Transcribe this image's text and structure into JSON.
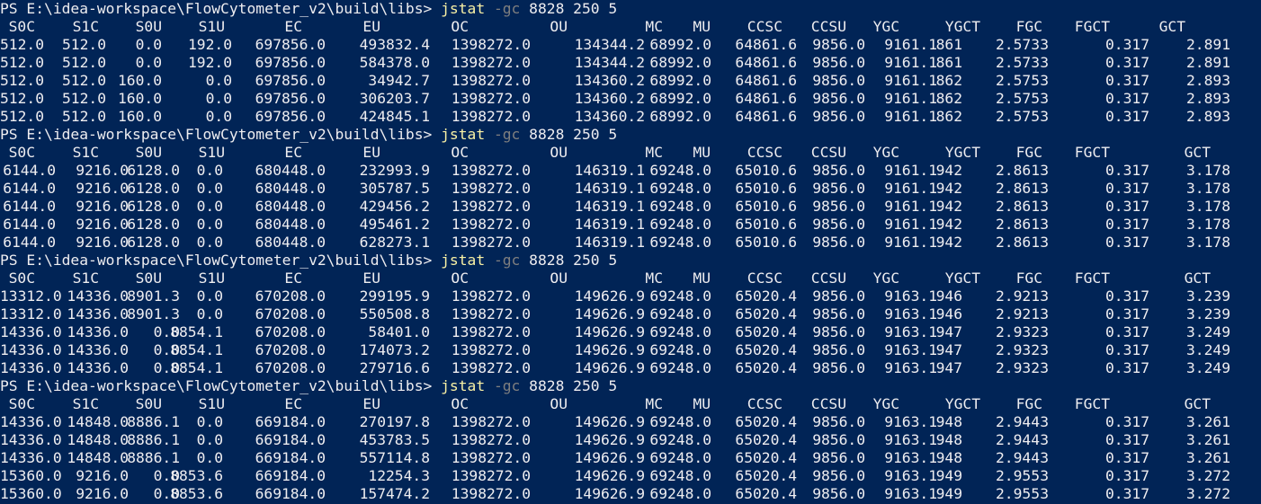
{
  "colors": {
    "background": "#012456",
    "foreground": "#eeedf0",
    "command": "#f9f1a5",
    "parameter": "#7f7f7f"
  },
  "blocks": [
    {
      "prompt": "PS E:\\idea-workspace\\FlowCytometer_v2\\build\\libs> ",
      "command": "jstat",
      "parameter": "-gc",
      "args": "8828 250 5",
      "header": [
        "S0C",
        "S1C",
        "S0U",
        "S1U",
        "EC",
        "EU",
        "OC",
        "OU",
        "MC",
        "MU",
        "CCSC",
        "CCSU",
        "YGC",
        "YGCT",
        "FGC",
        "FGCT",
        "GCT"
      ],
      "rows": [
        [
          "512.0",
          "512.0",
          "0.0",
          "192.0",
          "697856.0",
          "493832.4",
          "1398272.0",
          "134344.2",
          "68992.0",
          "64861.6",
          "9856.0",
          "9161.1",
          "861",
          "2.573",
          "3",
          "0.317",
          "2.891"
        ],
        [
          "512.0",
          "512.0",
          "0.0",
          "192.0",
          "697856.0",
          "584378.0",
          "1398272.0",
          "134344.2",
          "68992.0",
          "64861.6",
          "9856.0",
          "9161.1",
          "861",
          "2.573",
          "3",
          "0.317",
          "2.891"
        ],
        [
          "512.0",
          "512.0",
          "160.0",
          "0.0",
          "697856.0",
          "34942.7",
          "1398272.0",
          "134360.2",
          "68992.0",
          "64861.6",
          "9856.0",
          "9161.1",
          "862",
          "2.575",
          "3",
          "0.317",
          "2.893"
        ],
        [
          "512.0",
          "512.0",
          "160.0",
          "0.0",
          "697856.0",
          "306203.7",
          "1398272.0",
          "134360.2",
          "68992.0",
          "64861.6",
          "9856.0",
          "9161.1",
          "862",
          "2.575",
          "3",
          "0.317",
          "2.893"
        ],
        [
          "512.0",
          "512.0",
          "160.0",
          "0.0",
          "697856.0",
          "424845.1",
          "1398272.0",
          "134360.2",
          "68992.0",
          "64861.6",
          "9856.0",
          "9161.1",
          "862",
          "2.575",
          "3",
          "0.317",
          "2.893"
        ]
      ]
    },
    {
      "prompt": "PS E:\\idea-workspace\\FlowCytometer_v2\\build\\libs> ",
      "command": "jstat",
      "parameter": "-gc",
      "args": "8828 250 5",
      "header": [
        "S0C",
        "S1C",
        "S0U",
        "S1U",
        "EC",
        "EU",
        "OC",
        "OU",
        "MC",
        "MU",
        "CCSC",
        "CCSU",
        "YGC",
        "YGCT",
        "FGC",
        "FGCT",
        "GCT"
      ],
      "rows": [
        [
          "6144.0",
          "9216.0",
          "6128.0",
          "0.0",
          "680448.0",
          "232993.9",
          "1398272.0",
          "146319.1",
          "69248.0",
          "65010.6",
          "9856.0",
          "9161.1",
          "942",
          "2.861",
          "3",
          "0.317",
          "3.178"
        ],
        [
          "6144.0",
          "9216.0",
          "6128.0",
          "0.0",
          "680448.0",
          "305787.5",
          "1398272.0",
          "146319.1",
          "69248.0",
          "65010.6",
          "9856.0",
          "9161.1",
          "942",
          "2.861",
          "3",
          "0.317",
          "3.178"
        ],
        [
          "6144.0",
          "9216.0",
          "6128.0",
          "0.0",
          "680448.0",
          "429456.2",
          "1398272.0",
          "146319.1",
          "69248.0",
          "65010.6",
          "9856.0",
          "9161.1",
          "942",
          "2.861",
          "3",
          "0.317",
          "3.178"
        ],
        [
          "6144.0",
          "9216.0",
          "6128.0",
          "0.0",
          "680448.0",
          "495461.2",
          "1398272.0",
          "146319.1",
          "69248.0",
          "65010.6",
          "9856.0",
          "9161.1",
          "942",
          "2.861",
          "3",
          "0.317",
          "3.178"
        ],
        [
          "6144.0",
          "9216.0",
          "6128.0",
          "0.0",
          "680448.0",
          "628273.1",
          "1398272.0",
          "146319.1",
          "69248.0",
          "65010.6",
          "9856.0",
          "9161.1",
          "942",
          "2.861",
          "3",
          "0.317",
          "3.178"
        ]
      ]
    },
    {
      "prompt": "PS E:\\idea-workspace\\FlowCytometer_v2\\build\\libs> ",
      "command": "jstat",
      "parameter": "-gc",
      "args": "8828 250 5",
      "header": [
        "S0C",
        "S1C",
        "S0U",
        "S1U",
        "EC",
        "EU",
        "OC",
        "OU",
        "MC",
        "MU",
        "CCSC",
        "CCSU",
        "YGC",
        "YGCT",
        "FGC",
        "FGCT",
        "GCT"
      ],
      "rows": [
        [
          "13312.0",
          "14336.0",
          "8901.3",
          "0.0",
          "670208.0",
          "299195.9",
          "1398272.0",
          "149626.9",
          "69248.0",
          "65020.4",
          "9856.0",
          "9163.1",
          "946",
          "2.921",
          "3",
          "0.317",
          "3.239"
        ],
        [
          "13312.0",
          "14336.0",
          "8901.3",
          "0.0",
          "670208.0",
          "550508.8",
          "1398272.0",
          "149626.9",
          "69248.0",
          "65020.4",
          "9856.0",
          "9163.1",
          "946",
          "2.921",
          "3",
          "0.317",
          "3.239"
        ],
        [
          "14336.0",
          "14336.0",
          "0.0",
          "8854.1",
          "670208.0",
          "58401.0",
          "1398272.0",
          "149626.9",
          "69248.0",
          "65020.4",
          "9856.0",
          "9163.1",
          "947",
          "2.932",
          "3",
          "0.317",
          "3.249"
        ],
        [
          "14336.0",
          "14336.0",
          "0.0",
          "8854.1",
          "670208.0",
          "174073.2",
          "1398272.0",
          "149626.9",
          "69248.0",
          "65020.4",
          "9856.0",
          "9163.1",
          "947",
          "2.932",
          "3",
          "0.317",
          "3.249"
        ],
        [
          "14336.0",
          "14336.0",
          "0.0",
          "8854.1",
          "670208.0",
          "279716.6",
          "1398272.0",
          "149626.9",
          "69248.0",
          "65020.4",
          "9856.0",
          "9163.1",
          "947",
          "2.932",
          "3",
          "0.317",
          "3.249"
        ]
      ]
    },
    {
      "prompt": "PS E:\\idea-workspace\\FlowCytometer_v2\\build\\libs> ",
      "command": "jstat",
      "parameter": "-gc",
      "args": "8828 250 5",
      "header": [
        "S0C",
        "S1C",
        "S0U",
        "S1U",
        "EC",
        "EU",
        "OC",
        "OU",
        "MC",
        "MU",
        "CCSC",
        "CCSU",
        "YGC",
        "YGCT",
        "FGC",
        "FGCT",
        "GCT"
      ],
      "rows": [
        [
          "14336.0",
          "14848.0",
          "8886.1",
          "0.0",
          "669184.0",
          "270197.8",
          "1398272.0",
          "149626.9",
          "69248.0",
          "65020.4",
          "9856.0",
          "9163.1",
          "948",
          "2.944",
          "3",
          "0.317",
          "3.261"
        ],
        [
          "14336.0",
          "14848.0",
          "8886.1",
          "0.0",
          "669184.0",
          "453783.5",
          "1398272.0",
          "149626.9",
          "69248.0",
          "65020.4",
          "9856.0",
          "9163.1",
          "948",
          "2.944",
          "3",
          "0.317",
          "3.261"
        ],
        [
          "14336.0",
          "14848.0",
          "8886.1",
          "0.0",
          "669184.0",
          "557114.8",
          "1398272.0",
          "149626.9",
          "69248.0",
          "65020.4",
          "9856.0",
          "9163.1",
          "948",
          "2.944",
          "3",
          "0.317",
          "3.261"
        ],
        [
          "15360.0",
          "9216.0",
          "0.0",
          "8853.6",
          "669184.0",
          "12254.3",
          "1398272.0",
          "149626.9",
          "69248.0",
          "65020.4",
          "9856.0",
          "9163.1",
          "949",
          "2.955",
          "3",
          "0.317",
          "3.272"
        ],
        [
          "15360.0",
          "9216.0",
          "0.0",
          "8853.6",
          "669184.0",
          "157474.2",
          "1398272.0",
          "149626.9",
          "69248.0",
          "65020.4",
          "9856.0",
          "9163.1",
          "949",
          "2.955",
          "3",
          "0.317",
          "3.272"
        ]
      ]
    }
  ]
}
